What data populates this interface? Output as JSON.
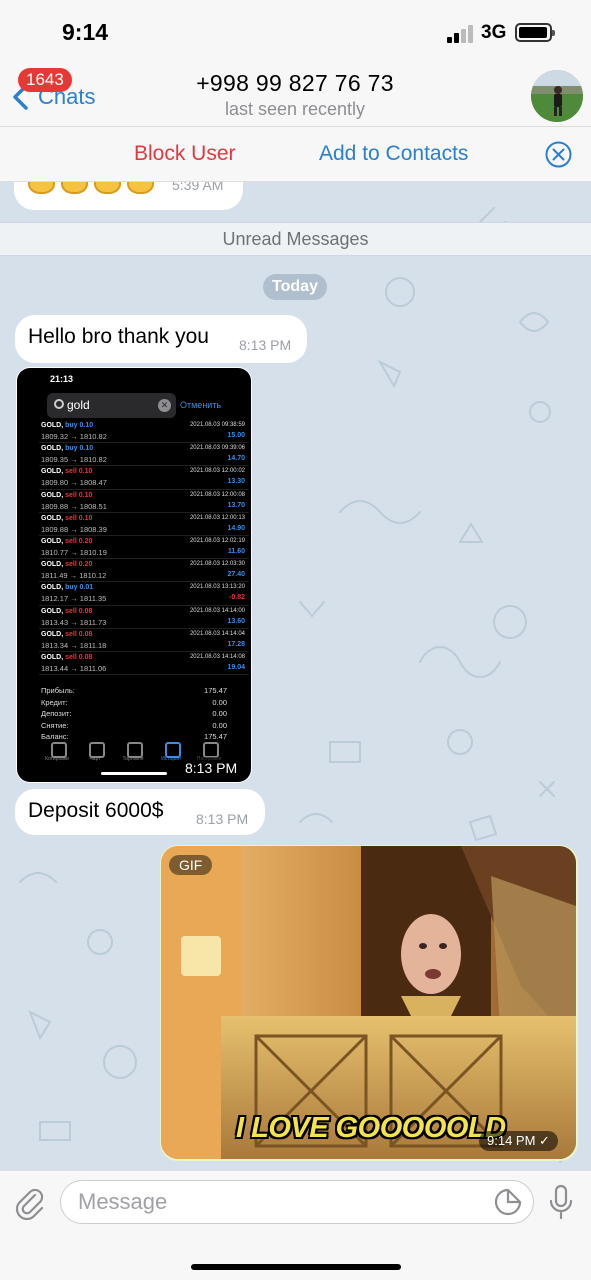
{
  "status_bar": {
    "time": "9:14",
    "network": "3G"
  },
  "header": {
    "back_label": "Chats",
    "unread_count": "1643",
    "title": "+998 99 827 76 73",
    "subtitle": "last seen recently"
  },
  "actions": {
    "block": "Block User",
    "add": "Add to Contacts"
  },
  "chat": {
    "emoji_message_time": "5:39 AM",
    "unread_divider": "Unread Messages",
    "date_label": "Today",
    "messages": [
      {
        "text": "Hello bro thank you",
        "time": "8:13 PM"
      },
      {
        "time": "8:13 PM"
      },
      {
        "text": "Deposit 6000$",
        "time": "8:13 PM"
      },
      {
        "gif_label": "GIF",
        "caption": "I LOVE GOOOOOLD",
        "time": "9:14 PM ✓"
      }
    ]
  },
  "screenshot": {
    "status_time": "21:13",
    "search_text": "gold",
    "cancel": "Отменить",
    "trades": [
      {
        "symbol": "GOLD,",
        "side": "buy 0.10",
        "side_type": "buy",
        "prices": "1809.32 → 1810.82",
        "date": "2021.08.03 09:38:59",
        "pnl": "15.00"
      },
      {
        "symbol": "GOLD,",
        "side": "buy 0.10",
        "side_type": "buy",
        "prices": "1809.35 → 1810.82",
        "date": "2021.08.03 09:39:06",
        "pnl": "14.70"
      },
      {
        "symbol": "GOLD,",
        "side": "sell 0.10",
        "side_type": "sell",
        "prices": "1809.80 → 1808.47",
        "date": "2021.08.03 12:00:02",
        "pnl": "13.30"
      },
      {
        "symbol": "GOLD,",
        "side": "sell 0.10",
        "side_type": "sell",
        "prices": "1809.88 → 1808.51",
        "date": "2021.08.03 12:00:08",
        "pnl": "13.70"
      },
      {
        "symbol": "GOLD,",
        "side": "sell 0.10",
        "side_type": "sell",
        "prices": "1809.88 → 1808.39",
        "date": "2021.08.03 12:00:13",
        "pnl": "14.90"
      },
      {
        "symbol": "GOLD,",
        "side": "sell 0.20",
        "side_type": "sell",
        "prices": "1810.77 → 1810.19",
        "date": "2021.08.03 12:02:19",
        "pnl": "11.60"
      },
      {
        "symbol": "GOLD,",
        "side": "sell 0.20",
        "side_type": "sell",
        "prices": "1811.49 → 1810.12",
        "date": "2021.08.03 12:03:30",
        "pnl": "27.40"
      },
      {
        "symbol": "GOLD,",
        "side": "buy 0.01",
        "side_type": "buy",
        "prices": "1812.17 → 1811.35",
        "date": "2021.08.03 13:13:20",
        "pnl": "-0.82"
      },
      {
        "symbol": "GOLD,",
        "side": "sell 0.08",
        "side_type": "sell",
        "prices": "1813.43 → 1811.73",
        "date": "2021.08.03 14:14:00",
        "pnl": "13.60"
      },
      {
        "symbol": "GOLD,",
        "side": "sell 0.08",
        "side_type": "sell",
        "prices": "1813.34 → 1811.18",
        "date": "2021.08.03 14:14:04",
        "pnl": "17.28"
      },
      {
        "symbol": "GOLD,",
        "side": "sell 0.08",
        "side_type": "sell",
        "prices": "1813.44 → 1811.06",
        "date": "2021.08.03 14:14:08",
        "pnl": "19.04"
      }
    ],
    "summary": [
      {
        "label": "Прибыль:",
        "value": "175.47"
      },
      {
        "label": "Кредит:",
        "value": "0.00"
      },
      {
        "label": "Депозит:",
        "value": "0.00"
      },
      {
        "label": "Снятие:",
        "value": "0.00"
      },
      {
        "label": "Баланс:",
        "value": "175.47"
      }
    ],
    "tabs": [
      "Котировки",
      "Чарт",
      "Торговля",
      "История",
      "Настройки"
    ]
  },
  "input": {
    "placeholder": "Message"
  },
  "colors": {
    "accent": "#2b7fd0",
    "danger": "#e0393e",
    "buy": "#3a8ee6",
    "sell": "#e53935"
  }
}
